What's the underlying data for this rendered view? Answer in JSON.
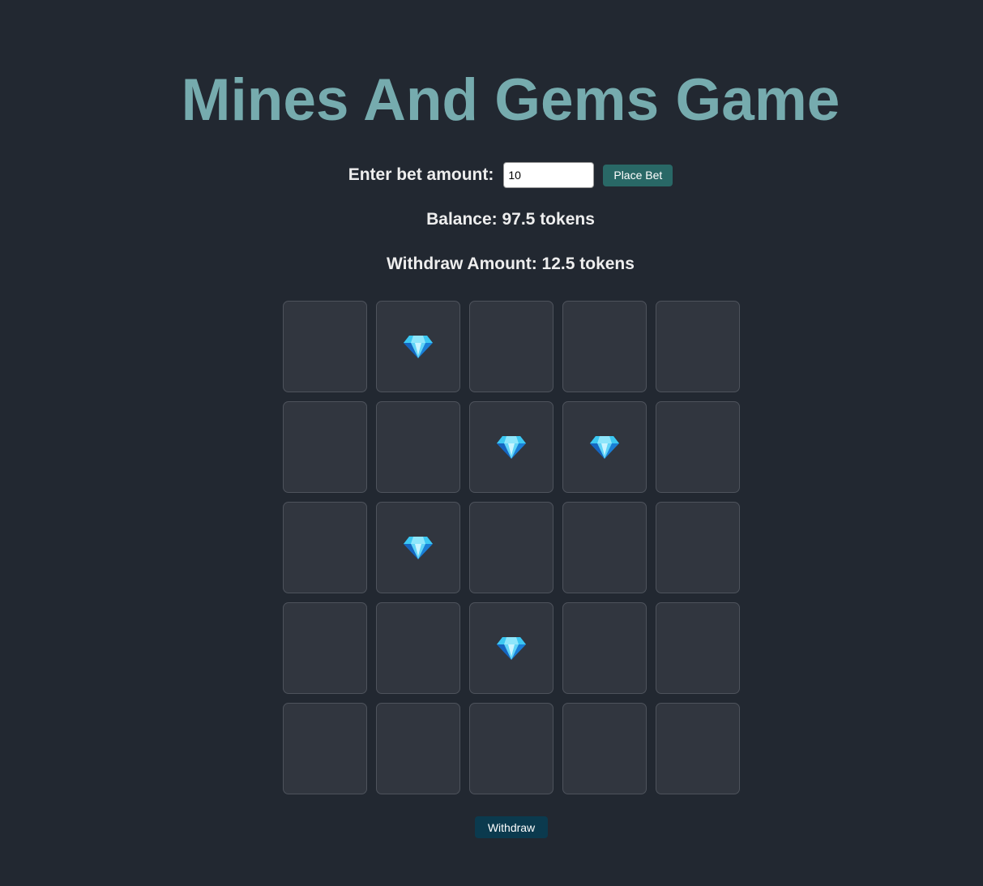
{
  "title": "Mines And Gems Game",
  "bet": {
    "label": "Enter bet amount:",
    "input_value": "10",
    "button_label": "Place Bet"
  },
  "balance_text": "Balance: 97.5 tokens",
  "withdraw_amount_text": "Withdraw Amount: 12.5 tokens",
  "withdraw_button_label": "Withdraw",
  "grid": {
    "rows": 5,
    "cols": 5,
    "cells": [
      "hidden",
      "gem",
      "hidden",
      "hidden",
      "hidden",
      "hidden",
      "hidden",
      "gem",
      "gem",
      "hidden",
      "hidden",
      "gem",
      "hidden",
      "hidden",
      "hidden",
      "hidden",
      "hidden",
      "gem",
      "hidden",
      "hidden",
      "hidden",
      "hidden",
      "hidden",
      "hidden",
      "hidden"
    ]
  },
  "icons": {
    "gem": "gem-icon"
  },
  "colors": {
    "background": "#222831",
    "title": "#76abae",
    "place_bet_button": "#296866",
    "withdraw_button": "#0b3a4e",
    "cell": "#31363f"
  }
}
